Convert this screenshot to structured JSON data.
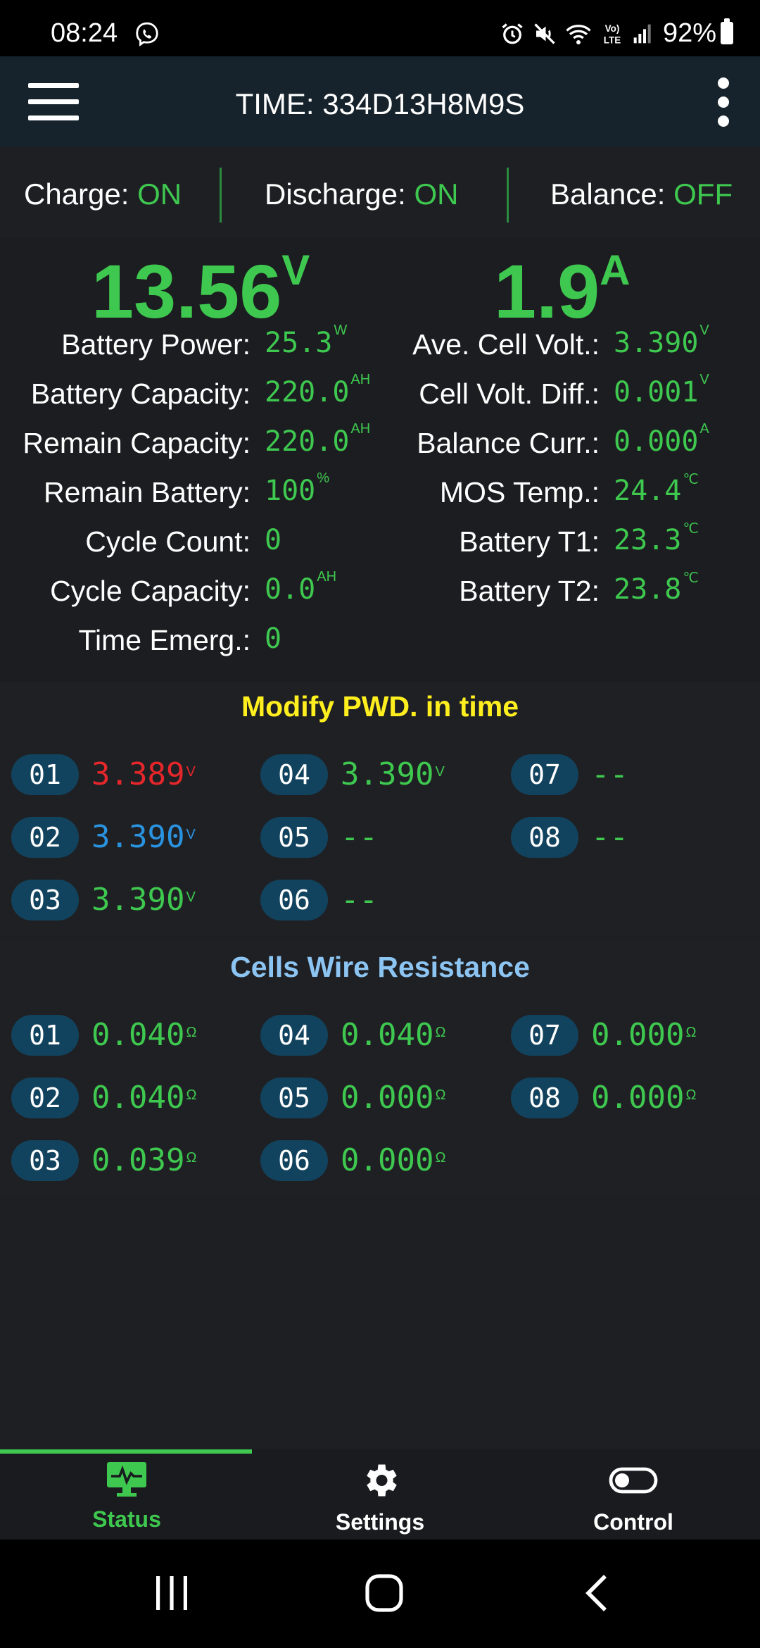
{
  "status_bar": {
    "time": "08:24",
    "battery": "92%"
  },
  "app_bar": {
    "title": "TIME: 334D13H8M9S"
  },
  "states": {
    "charge": {
      "label": "Charge:",
      "value": "ON"
    },
    "discharge": {
      "label": "Discharge:",
      "value": "ON"
    },
    "balance": {
      "label": "Balance:",
      "value": "OFF"
    }
  },
  "voltage": {
    "value": "13.56",
    "unit": "V"
  },
  "current": {
    "value": "1.9",
    "unit": "A"
  },
  "left_stats": [
    {
      "label": "Battery Power:",
      "value": "25.3",
      "unit": "W"
    },
    {
      "label": "Battery Capacity:",
      "value": "220.0",
      "unit": "AH"
    },
    {
      "label": "Remain Capacity:",
      "value": "220.0",
      "unit": "AH"
    },
    {
      "label": "Remain Battery:",
      "value": "100",
      "unit": "%"
    },
    {
      "label": "Cycle Count:",
      "value": "0",
      "unit": ""
    },
    {
      "label": "Cycle Capacity:",
      "value": "0.0",
      "unit": "AH"
    },
    {
      "label": "Time Emerg.:",
      "value": "0",
      "unit": ""
    }
  ],
  "right_stats": [
    {
      "label": "Ave. Cell Volt.:",
      "value": "3.390",
      "unit": "V"
    },
    {
      "label": "Cell Volt. Diff.:",
      "value": "0.001",
      "unit": "V"
    },
    {
      "label": "Balance Curr.:",
      "value": "0.000",
      "unit": "A"
    },
    {
      "label": "MOS Temp.:",
      "value": "24.4",
      "unit": "℃"
    },
    {
      "label": "Battery T1:",
      "value": "23.3",
      "unit": "℃"
    },
    {
      "label": "Battery T2:",
      "value": "23.8",
      "unit": "℃"
    }
  ],
  "cell_voltages": {
    "title": "Modify PWD. in time",
    "title_color": "#ffef1f",
    "cells": [
      {
        "id": "01",
        "value": "3.389",
        "unit": "V"
      },
      {
        "id": "02",
        "value": "3.390",
        "unit": "V"
      },
      {
        "id": "03",
        "value": "3.390",
        "unit": "V"
      },
      {
        "id": "04",
        "value": "3.390",
        "unit": "V"
      },
      {
        "id": "05",
        "value": "--",
        "unit": ""
      },
      {
        "id": "06",
        "value": "--",
        "unit": ""
      },
      {
        "id": "07",
        "value": "--",
        "unit": ""
      },
      {
        "id": "08",
        "value": "--",
        "unit": ""
      }
    ]
  },
  "wire_resistance": {
    "title": "Cells Wire Resistance",
    "title_color": "#8cc4f2",
    "cells": [
      {
        "id": "01",
        "value": "0.040",
        "unit": "Ω"
      },
      {
        "id": "02",
        "value": "0.040",
        "unit": "Ω"
      },
      {
        "id": "03",
        "value": "0.039",
        "unit": "Ω"
      },
      {
        "id": "04",
        "value": "0.040",
        "unit": "Ω"
      },
      {
        "id": "05",
        "value": "0.000",
        "unit": "Ω"
      },
      {
        "id": "06",
        "value": "0.000",
        "unit": "Ω"
      },
      {
        "id": "07",
        "value": "0.000",
        "unit": "Ω"
      },
      {
        "id": "08",
        "value": "0.000",
        "unit": "Ω"
      }
    ]
  },
  "bottom_nav": {
    "status": "Status",
    "settings": "Settings",
    "control": "Control",
    "active": "Status",
    "active_color": "#3ec84f"
  },
  "colors": {
    "green": "#3ec84f",
    "red": "#e5262a",
    "blue": "#2a93e0",
    "pill": "#12435e"
  }
}
